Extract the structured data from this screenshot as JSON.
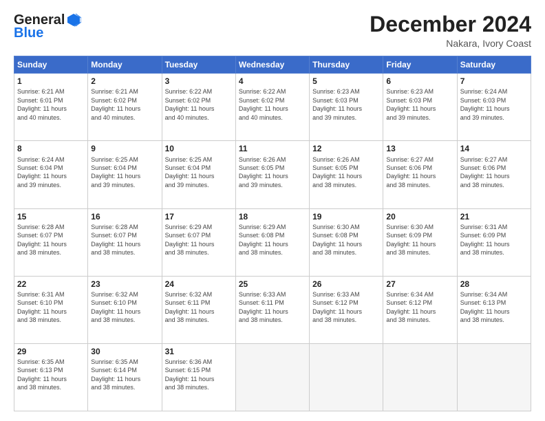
{
  "header": {
    "logo_general": "General",
    "logo_blue": "Blue",
    "title": "December 2024",
    "subtitle": "Nakara, Ivory Coast"
  },
  "weekdays": [
    "Sunday",
    "Monday",
    "Tuesday",
    "Wednesday",
    "Thursday",
    "Friday",
    "Saturday"
  ],
  "weeks": [
    [
      {
        "day": "1",
        "info": "Sunrise: 6:21 AM\nSunset: 6:01 PM\nDaylight: 11 hours\nand 40 minutes."
      },
      {
        "day": "2",
        "info": "Sunrise: 6:21 AM\nSunset: 6:02 PM\nDaylight: 11 hours\nand 40 minutes."
      },
      {
        "day": "3",
        "info": "Sunrise: 6:22 AM\nSunset: 6:02 PM\nDaylight: 11 hours\nand 40 minutes."
      },
      {
        "day": "4",
        "info": "Sunrise: 6:22 AM\nSunset: 6:02 PM\nDaylight: 11 hours\nand 40 minutes."
      },
      {
        "day": "5",
        "info": "Sunrise: 6:23 AM\nSunset: 6:03 PM\nDaylight: 11 hours\nand 39 minutes."
      },
      {
        "day": "6",
        "info": "Sunrise: 6:23 AM\nSunset: 6:03 PM\nDaylight: 11 hours\nand 39 minutes."
      },
      {
        "day": "7",
        "info": "Sunrise: 6:24 AM\nSunset: 6:03 PM\nDaylight: 11 hours\nand 39 minutes."
      }
    ],
    [
      {
        "day": "8",
        "info": "Sunrise: 6:24 AM\nSunset: 6:04 PM\nDaylight: 11 hours\nand 39 minutes."
      },
      {
        "day": "9",
        "info": "Sunrise: 6:25 AM\nSunset: 6:04 PM\nDaylight: 11 hours\nand 39 minutes."
      },
      {
        "day": "10",
        "info": "Sunrise: 6:25 AM\nSunset: 6:04 PM\nDaylight: 11 hours\nand 39 minutes."
      },
      {
        "day": "11",
        "info": "Sunrise: 6:26 AM\nSunset: 6:05 PM\nDaylight: 11 hours\nand 39 minutes."
      },
      {
        "day": "12",
        "info": "Sunrise: 6:26 AM\nSunset: 6:05 PM\nDaylight: 11 hours\nand 38 minutes."
      },
      {
        "day": "13",
        "info": "Sunrise: 6:27 AM\nSunset: 6:06 PM\nDaylight: 11 hours\nand 38 minutes."
      },
      {
        "day": "14",
        "info": "Sunrise: 6:27 AM\nSunset: 6:06 PM\nDaylight: 11 hours\nand 38 minutes."
      }
    ],
    [
      {
        "day": "15",
        "info": "Sunrise: 6:28 AM\nSunset: 6:07 PM\nDaylight: 11 hours\nand 38 minutes."
      },
      {
        "day": "16",
        "info": "Sunrise: 6:28 AM\nSunset: 6:07 PM\nDaylight: 11 hours\nand 38 minutes."
      },
      {
        "day": "17",
        "info": "Sunrise: 6:29 AM\nSunset: 6:07 PM\nDaylight: 11 hours\nand 38 minutes."
      },
      {
        "day": "18",
        "info": "Sunrise: 6:29 AM\nSunset: 6:08 PM\nDaylight: 11 hours\nand 38 minutes."
      },
      {
        "day": "19",
        "info": "Sunrise: 6:30 AM\nSunset: 6:08 PM\nDaylight: 11 hours\nand 38 minutes."
      },
      {
        "day": "20",
        "info": "Sunrise: 6:30 AM\nSunset: 6:09 PM\nDaylight: 11 hours\nand 38 minutes."
      },
      {
        "day": "21",
        "info": "Sunrise: 6:31 AM\nSunset: 6:09 PM\nDaylight: 11 hours\nand 38 minutes."
      }
    ],
    [
      {
        "day": "22",
        "info": "Sunrise: 6:31 AM\nSunset: 6:10 PM\nDaylight: 11 hours\nand 38 minutes."
      },
      {
        "day": "23",
        "info": "Sunrise: 6:32 AM\nSunset: 6:10 PM\nDaylight: 11 hours\nand 38 minutes."
      },
      {
        "day": "24",
        "info": "Sunrise: 6:32 AM\nSunset: 6:11 PM\nDaylight: 11 hours\nand 38 minutes."
      },
      {
        "day": "25",
        "info": "Sunrise: 6:33 AM\nSunset: 6:11 PM\nDaylight: 11 hours\nand 38 minutes."
      },
      {
        "day": "26",
        "info": "Sunrise: 6:33 AM\nSunset: 6:12 PM\nDaylight: 11 hours\nand 38 minutes."
      },
      {
        "day": "27",
        "info": "Sunrise: 6:34 AM\nSunset: 6:12 PM\nDaylight: 11 hours\nand 38 minutes."
      },
      {
        "day": "28",
        "info": "Sunrise: 6:34 AM\nSunset: 6:13 PM\nDaylight: 11 hours\nand 38 minutes."
      }
    ],
    [
      {
        "day": "29",
        "info": "Sunrise: 6:35 AM\nSunset: 6:13 PM\nDaylight: 11 hours\nand 38 minutes."
      },
      {
        "day": "30",
        "info": "Sunrise: 6:35 AM\nSunset: 6:14 PM\nDaylight: 11 hours\nand 38 minutes."
      },
      {
        "day": "31",
        "info": "Sunrise: 6:36 AM\nSunset: 6:15 PM\nDaylight: 11 hours\nand 38 minutes."
      },
      null,
      null,
      null,
      null
    ]
  ]
}
